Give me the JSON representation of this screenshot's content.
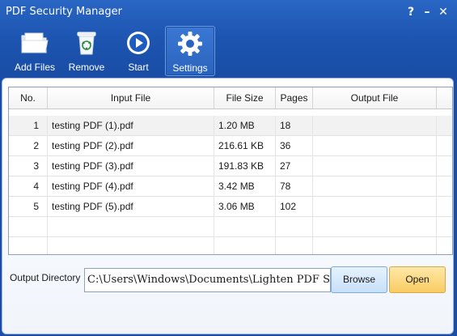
{
  "window": {
    "title": "PDF Security Manager",
    "help_glyph": "?",
    "minimize_glyph": "–",
    "close_glyph": "✕"
  },
  "toolbar": {
    "items": [
      {
        "label": "Add Files",
        "icon": "folder-icon"
      },
      {
        "label": "Remove",
        "icon": "recycle-bin-icon"
      },
      {
        "label": "Start",
        "icon": "play-icon"
      },
      {
        "label": "Settings",
        "icon": "gear-icon",
        "active": true
      }
    ]
  },
  "table": {
    "columns": [
      "No.",
      "Input File",
      "File Size",
      "Pages",
      "Output File"
    ],
    "rows": [
      {
        "no": "1",
        "input": "testing PDF (1).pdf",
        "size": "1.20 MB",
        "pages": "18",
        "output": ""
      },
      {
        "no": "2",
        "input": "testing PDF (2).pdf",
        "size": "216.61 KB",
        "pages": "36",
        "output": ""
      },
      {
        "no": "3",
        "input": "testing PDF (3).pdf",
        "size": "191.83 KB",
        "pages": "27",
        "output": ""
      },
      {
        "no": "4",
        "input": "testing PDF (4).pdf",
        "size": "3.42 MB",
        "pages": "78",
        "output": ""
      },
      {
        "no": "5",
        "input": "testing PDF (5).pdf",
        "size": "3.06 MB",
        "pages": "102",
        "output": ""
      }
    ],
    "selected_row": 0
  },
  "output": {
    "label": "Output Directory",
    "value": "C:\\Users\\Windows\\Documents\\Lighten PDF Security",
    "browse_label": "Browse",
    "open_label": "Open"
  },
  "colors": {
    "window_blue": "#1a4ea6",
    "browse_button": "#c6e0f8",
    "open_button": "#f9cc62"
  }
}
